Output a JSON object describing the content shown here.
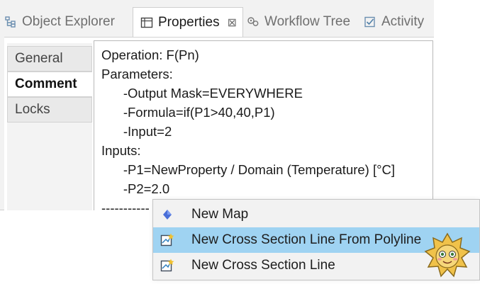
{
  "tabs": [
    {
      "label": "Object Explorer",
      "icon": "object-explorer-icon",
      "active": false
    },
    {
      "label": "Properties",
      "icon": "properties-icon",
      "active": true,
      "close": "⊠"
    },
    {
      "label": "Workflow Tree",
      "icon": "workflow-tree-icon",
      "active": false
    },
    {
      "label": "Activity",
      "icon": "activity-icon",
      "active": false
    }
  ],
  "side_tabs": [
    {
      "label": "General",
      "selected": false
    },
    {
      "label": "Comment",
      "selected": true
    },
    {
      "label": "Locks",
      "selected": false
    }
  ],
  "comment_lines": [
    "Operation: F(Pn)",
    "Parameters:",
    "      -Output Mask=EVERYWHERE",
    "      -Formula=if(P1>40,40,P1)",
    "      -Input=2",
    "Inputs:",
    "      -P1=NewProperty / Domain (Temperature) [°C]",
    "      -P2=2.0",
    "-----------"
  ],
  "context_menu": [
    {
      "label": "New Map",
      "icon": "map-diamond-icon",
      "highlighted": false
    },
    {
      "label": "New Cross Section Line From Polyline",
      "icon": "cross-section-icon",
      "highlighted": true
    },
    {
      "label": "New Cross Section Line",
      "icon": "cross-section-icon",
      "highlighted": false
    }
  ],
  "colors": {
    "menu_highlight": "#9fd3f2",
    "diamond_icon": "#4a6fd8"
  }
}
